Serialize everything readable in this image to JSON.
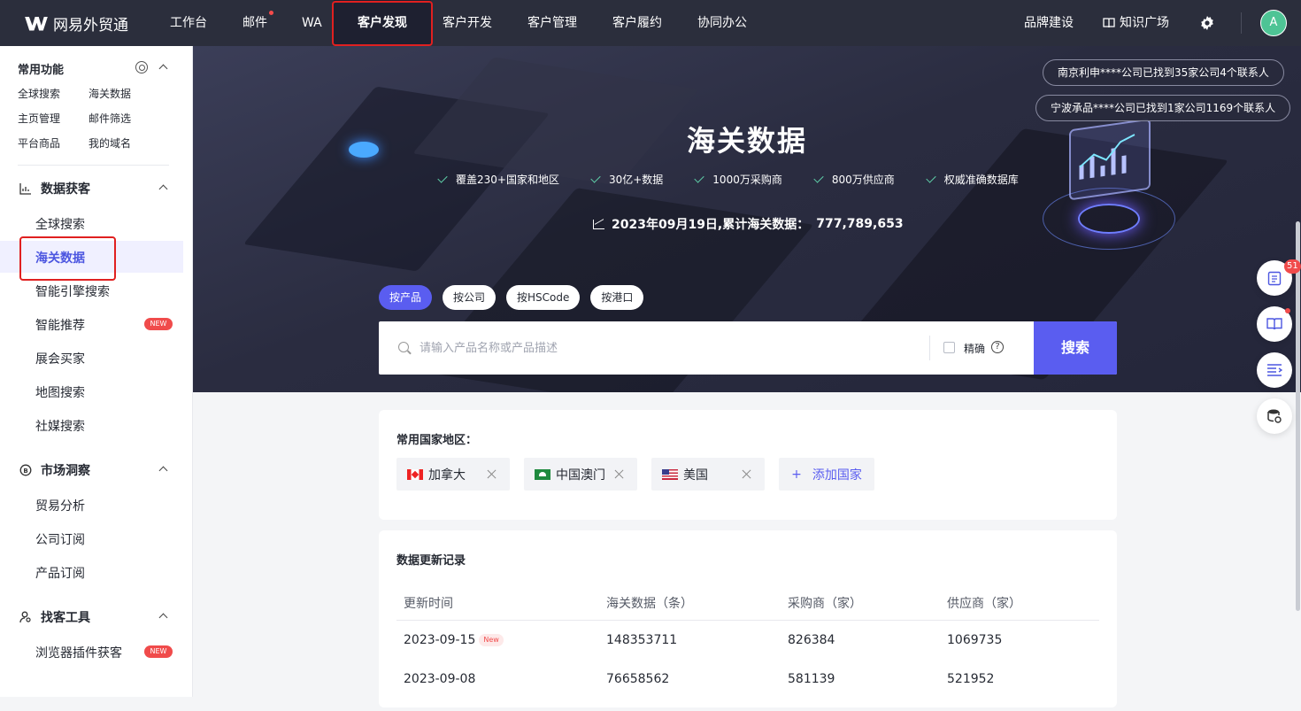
{
  "app": {
    "name": "网易外贸通"
  },
  "topnav": {
    "items": [
      "工作台",
      "邮件",
      "WA",
      "客户发现",
      "客户开发",
      "客户管理",
      "客户履约",
      "协同办公"
    ],
    "active": "客户发现",
    "right": {
      "brand": "品牌建设",
      "knowledge": "知识广场",
      "avatar_letter": "A"
    }
  },
  "sidebar": {
    "common_title": "常用功能",
    "quick": [
      "全球搜索",
      "海关数据",
      "主页管理",
      "邮件筛选",
      "平台商品",
      "我的域名"
    ],
    "groups": [
      {
        "title": "数据获客",
        "items": [
          "全球搜索",
          "海关数据",
          "智能引擎搜索",
          "智能推荐",
          "展会买家",
          "地图搜索",
          "社媒搜索"
        ]
      },
      {
        "title": "市场洞察",
        "items": [
          "贸易分析",
          "公司订阅",
          "产品订阅"
        ]
      },
      {
        "title": "找客工具",
        "items": [
          "浏览器插件获客"
        ]
      }
    ],
    "active_item": "海关数据",
    "new_badge": "NEW"
  },
  "hero": {
    "title": "海关数据",
    "features": [
      "覆盖230+国家和地区",
      "30亿+数据",
      "1000万采购商",
      "800万供应商",
      "权威准确数据库"
    ],
    "stat_label": "2023年09月19日,累计海关数据：",
    "stat_value": "777,789,653",
    "notices": [
      "南京利申****公司已找到35家公司4个联系人",
      "宁波承品****公司已找到1家公司1169个联系人"
    ]
  },
  "search": {
    "tabs": [
      "按产品",
      "按公司",
      "按HSCode",
      "按港口"
    ],
    "active_tab": "按产品",
    "placeholder": "请输入产品名称或产品描述",
    "value": "",
    "exact_label": "精确",
    "help": "?",
    "button": "搜索"
  },
  "countries": {
    "title": "常用国家地区：",
    "items": [
      {
        "name": "加拿大",
        "flag": "flag-ca"
      },
      {
        "name": "中国澳门",
        "flag": "flag-mo"
      },
      {
        "name": "美国",
        "flag": "flag-us"
      }
    ],
    "add_label": "添加国家",
    "add_icon": "+"
  },
  "updates": {
    "title": "数据更新记录",
    "columns": [
      "更新时间",
      "海关数据（条）",
      "采购商（家）",
      "供应商（家）"
    ],
    "rows": [
      {
        "date": "2023-09-15",
        "tag": "New",
        "customs": "148353711",
        "buyers": "826384",
        "suppliers": "1069735"
      },
      {
        "date": "2023-09-08",
        "tag": "",
        "customs": "76658562",
        "buyers": "581139",
        "suppliers": "521952"
      }
    ]
  },
  "floating": {
    "badge_count": "51"
  },
  "colors": {
    "accent": "#5a5df0",
    "nav_bg": "#2b2e3c",
    "highlight_box": "#e02020"
  }
}
